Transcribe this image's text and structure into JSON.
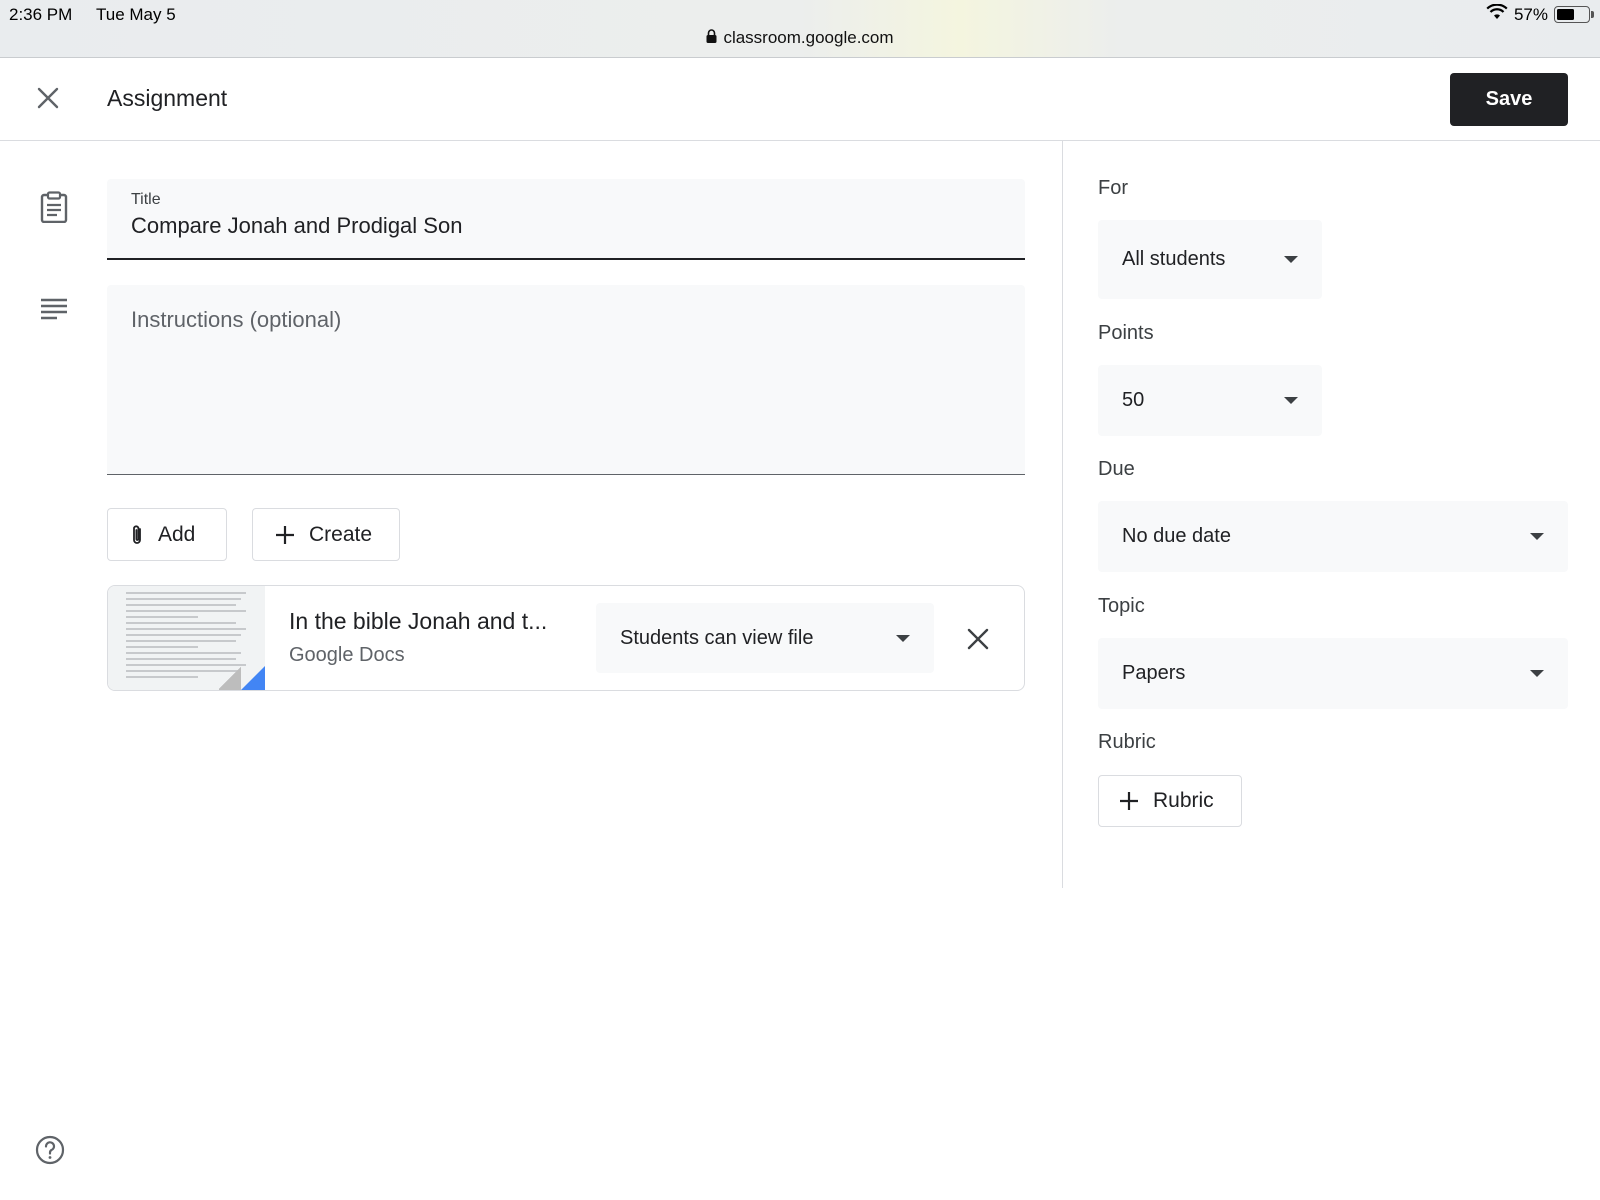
{
  "status_bar": {
    "time": "2:36 PM",
    "date": "Tue May 5",
    "battery": "57%",
    "battery_level": 0.57,
    "url": "classroom.google.com"
  },
  "header": {
    "title": "Assignment",
    "save_label": "Save"
  },
  "form": {
    "title_label": "Title",
    "title_value": "Compare Jonah and Prodigal Son",
    "instructions_placeholder": "Instructions (optional)",
    "add_label": "Add",
    "create_label": "Create"
  },
  "attachment": {
    "name": "In the bible Jonah and t...",
    "type": "Google Docs",
    "permission": "Students can view file"
  },
  "settings": {
    "for_label": "For",
    "for_value": "All students",
    "points_label": "Points",
    "points_value": "50",
    "due_label": "Due",
    "due_value": "No due date",
    "topic_label": "Topic",
    "topic_value": "Papers",
    "rubric_label": "Rubric",
    "rubric_button": "Rubric"
  },
  "icons": {
    "close": "close-icon",
    "assignment": "clipboard-icon",
    "instructions": "notes-icon",
    "attach": "paperclip-icon",
    "create": "plus-icon",
    "help": "help-icon",
    "wifi": "wifi-icon",
    "lock": "lock-icon"
  },
  "colors": {
    "save_bg": "#202124",
    "field_bg": "#f8f9fa",
    "doc_accent": "#4285f4"
  }
}
